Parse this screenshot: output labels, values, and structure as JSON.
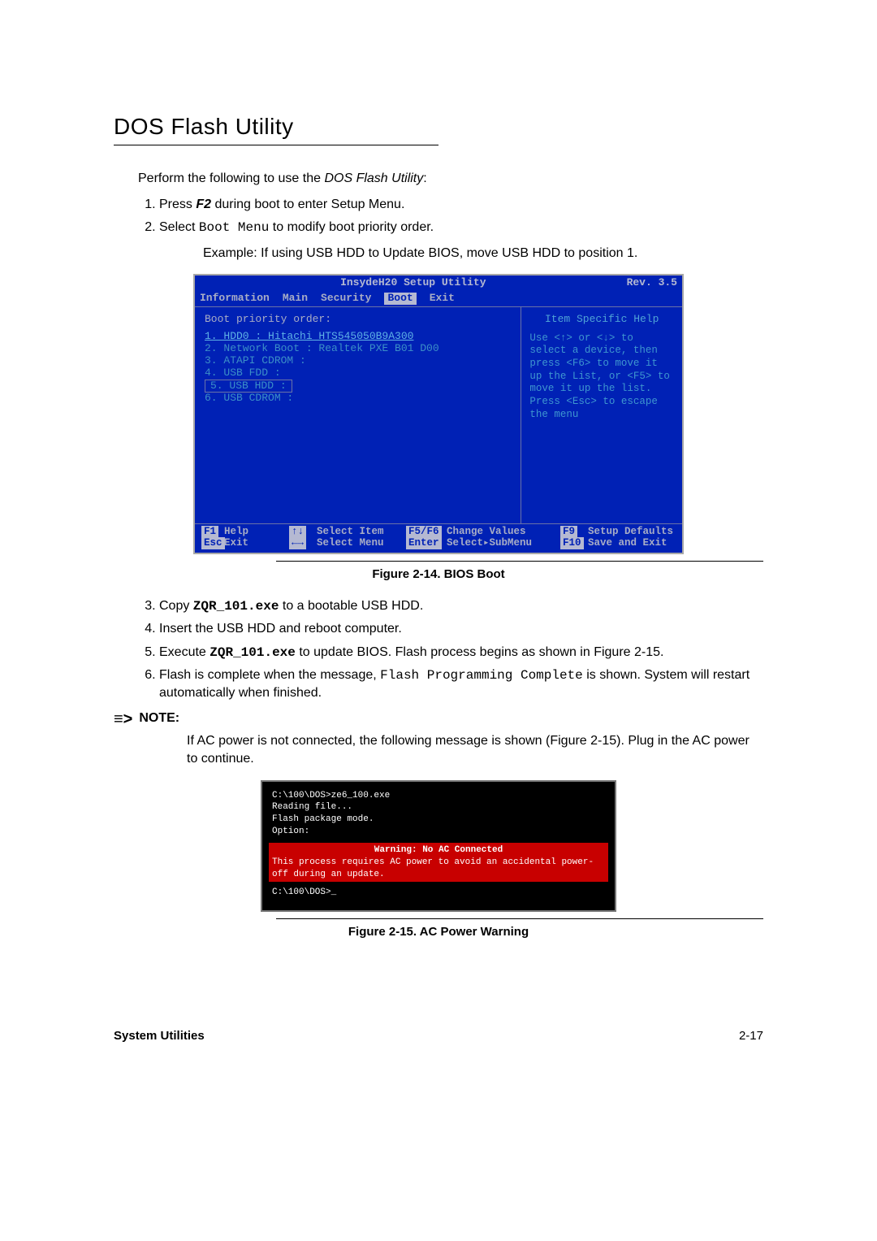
{
  "title": "DOS Flash Utility",
  "intro": {
    "prefix": "Perform the following to use the ",
    "app": "DOS Flash Utility",
    "suffix": ":"
  },
  "steps1": {
    "s1a": "Press ",
    "s1b": "F2",
    "s1c": " during boot to enter Setup Menu.",
    "s2a": "Select ",
    "s2b": "Boot Menu",
    "s2c": " to modify boot priority order."
  },
  "example": "Example: If using USB HDD to Update BIOS, move USB HDD to position 1.",
  "bios": {
    "header_left": "InsydeH20 Setup Utility",
    "header_right": "Rev. 3.5",
    "menu": [
      "Information",
      "Main",
      "Security",
      "Boot",
      "Exit"
    ],
    "menu_selected": "Boot",
    "left_label": "Boot priority order:",
    "devices": [
      "1. HDD0 : Hitachi HTS545050B9A300",
      "2. Network Boot : Realtek PXE B01 D00",
      "3. ATAPI CDROM :",
      "4. USB FDD :",
      "5. USB HDD :",
      "6. USB CDROM :"
    ],
    "help_hdr": "Item Specific Help",
    "help_body": "Use <↑> or <↓> to select a device, then press <F6> to move it up the List, or <F5> to move it up the list. Press <Esc> to escape the menu",
    "footer": {
      "k1": "F1",
      "l1": "Help",
      "k2": "↑↓",
      "l2": "Select Item",
      "k3": "F5/F6",
      "l3": "Change Values",
      "k4": "F9",
      "l4": "Setup Defaults",
      "k5": "Esc",
      "l5": "Exit",
      "k6": "←→",
      "l6": "Select Menu",
      "k7": "Enter",
      "l7": "Select▸SubMenu",
      "k8": "F10",
      "l8": "Save and Exit"
    }
  },
  "fig1": "Figure 2-14.   BIOS Boot",
  "steps2": {
    "s3a": "Copy ",
    "s3b": "ZQR_101.exe",
    "s3c": " to a bootable USB HDD.",
    "s4": "Insert the USB HDD and reboot computer.",
    "s5a": "Execute ",
    "s5b": "ZQR_101.exe",
    "s5c": " to update BIOS. Flash process begins as shown in Figure 2-15.",
    "s6a": "Flash is complete when the message, ",
    "s6b": "Flash Programming Complete",
    "s6c": " is shown. System will restart automatically when finished."
  },
  "note_label": "NOTE:",
  "note_body": "If AC power is not connected, the following message is shown (Figure 2-15). Plug in the AC power to continue.",
  "dos": {
    "l1": "C:\\100\\DOS>ze6_100.exe",
    "l2": "Reading file...",
    "l3": "Flash package mode.",
    "l4": "Option:",
    "warn_title": "Warning: No AC Connected",
    "warn_body": "This process requires AC power to avoid an accidental power-off during an update.",
    "l5": "C:\\100\\DOS>_"
  },
  "fig2": "Figure 2-15.   AC Power Warning",
  "footer_left": "System Utilities",
  "footer_right": "2-17"
}
